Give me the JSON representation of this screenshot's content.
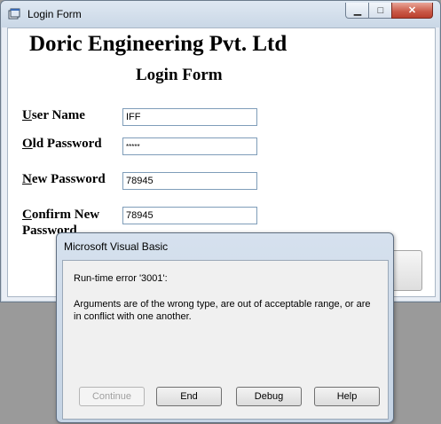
{
  "window": {
    "title": "Login Form",
    "minimize_glyph": "▁",
    "maximize_glyph": "□",
    "close_glyph": "✕"
  },
  "form": {
    "company": "Doric Engineering Pvt. Ltd",
    "title": "Login Form",
    "fields": {
      "user_name": {
        "label_accel": "U",
        "label_rest": "ser Name",
        "value": "IFF"
      },
      "old_password": {
        "label_accel": "O",
        "label_rest": "ld Password",
        "value": "*****"
      },
      "new_password": {
        "label_accel": "N",
        "label_rest": "ew Password",
        "value": "78945"
      },
      "confirm_password": {
        "label_accel": "C",
        "label_rest": "onfirm New Password",
        "value": "78945"
      }
    }
  },
  "dialog": {
    "title": "Microsoft Visual Basic",
    "error_code": "Run-time error '3001':",
    "message": "Arguments are of the wrong type, are out of acceptable range, or are in conflict with one another.",
    "buttons": {
      "continue": "Continue",
      "end": "End",
      "debug": "Debug",
      "help": "Help"
    }
  },
  "colors": {
    "titlebar": "#c9d7e6",
    "close_button": "#c95846",
    "background": "#9a9a9a"
  }
}
